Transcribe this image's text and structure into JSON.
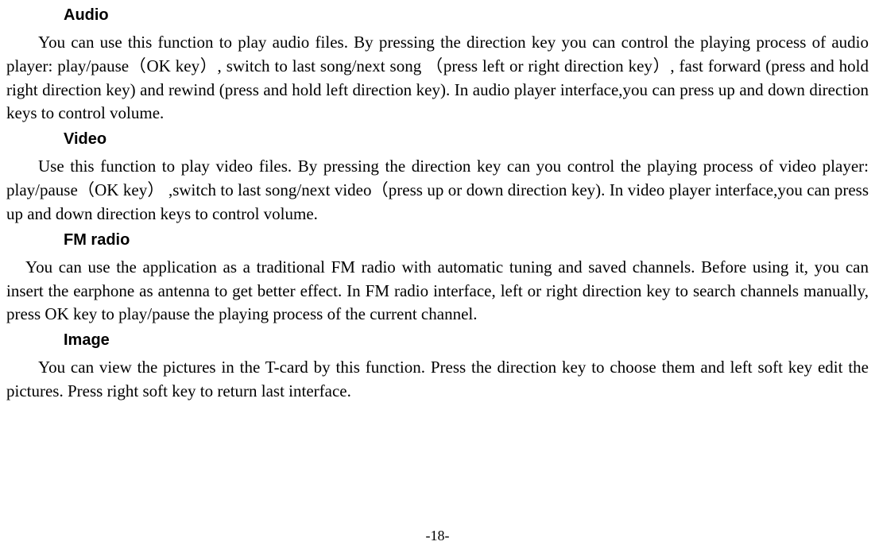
{
  "sections": {
    "audio": {
      "heading": "Audio",
      "body": "You can use this function to play audio files. By pressing the direction key you can control the playing process of audio player: play/pause（OK key）, switch to last song/next song  （press left or right direction key）, fast forward (press and hold right direction key) and rewind (press and hold left direction key). In audio player interface,you can press up and down direction keys to control volume."
    },
    "video": {
      "heading": "Video",
      "body": "Use this function to play video files. By pressing the direction key can you control the playing process of video player: play/pause（OK key） ,switch to last song/next video（press up or down direction key). In video player interface,you can press up and down direction keys to control volume."
    },
    "fmradio": {
      "heading": "FM radio",
      "body": "You can use the application as a traditional FM radio with automatic tuning and saved channels. Before using it, you can insert the earphone as antenna to get better effect. In FM radio interface, left or right direction key to search channels manually, press OK key to play/pause the playing process of the current channel."
    },
    "image": {
      "heading": "Image",
      "body": "You can view the pictures in the T-card by this function. Press the direction key to choose them and left soft key edit the pictures. Press right soft key to return last interface."
    }
  },
  "page_number": "-18-"
}
